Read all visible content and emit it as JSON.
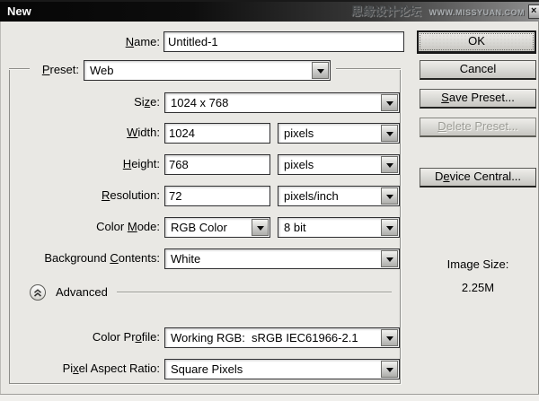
{
  "window": {
    "title": "New",
    "watermark_cn": "思缘设计论坛",
    "watermark_en": "WWW.MISSYUAN.COM",
    "close_glyph": "×"
  },
  "fields": {
    "name": {
      "pre": "",
      "mn": "N",
      "post": "ame:",
      "value": "Untitled-1"
    },
    "preset": {
      "pre": "",
      "mn": "P",
      "post": "reset:",
      "value": "Web"
    },
    "size": {
      "pre": "Si",
      "mn": "z",
      "post": "e:",
      "value": "1024 x 768"
    },
    "width": {
      "pre": "",
      "mn": "W",
      "post": "idth:",
      "value": "1024",
      "unit": "pixels"
    },
    "height": {
      "pre": "",
      "mn": "H",
      "post": "eight:",
      "value": "768",
      "unit": "pixels"
    },
    "resolution": {
      "pre": "",
      "mn": "R",
      "post": "esolution:",
      "value": "72",
      "unit": "pixels/inch"
    },
    "color_mode": {
      "pre": "Color ",
      "mn": "M",
      "post": "ode:",
      "value": "RGB Color",
      "unit": "8 bit"
    },
    "background": {
      "pre": "Background ",
      "mn": "C",
      "post": "ontents:",
      "value": "White"
    },
    "color_profile": {
      "pre": "Color Pr",
      "mn": "o",
      "post": "file:",
      "value": "Working RGB:  sRGB IEC61966-2.1"
    },
    "pixel_aspect": {
      "pre": "Pi",
      "mn": "x",
      "post": "el Aspect Ratio:",
      "value": "Square Pixels"
    }
  },
  "advanced": {
    "label": "Advanced"
  },
  "buttons": {
    "ok": {
      "label": "OK"
    },
    "cancel": {
      "label": "Cancel"
    },
    "save_preset": {
      "pre": "",
      "mn": "S",
      "post": "ave Preset..."
    },
    "delete_preset": {
      "pre": "",
      "mn": "D",
      "post": "elete Preset..."
    },
    "device_central": {
      "pre": "D",
      "mn": "e",
      "post": "vice Central..."
    }
  },
  "info": {
    "image_size_label": "Image Size:",
    "image_size_value": "2.25M"
  }
}
